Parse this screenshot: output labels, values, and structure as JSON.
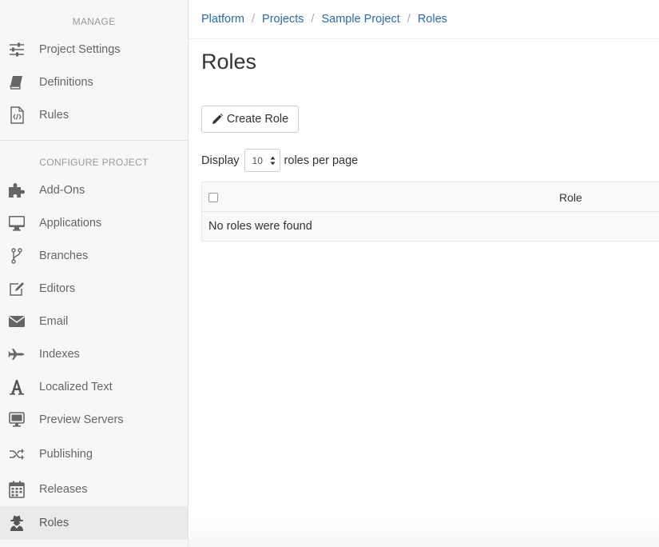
{
  "sidebar": {
    "manage_header": "MANAGE",
    "manage_items": [
      {
        "label": "Project Settings",
        "icon": "sliders-icon"
      },
      {
        "label": "Definitions",
        "icon": "book-icon"
      },
      {
        "label": "Rules",
        "icon": "code-file-icon"
      }
    ],
    "configure_header": "CONFIGURE PROJECT",
    "configure_items": [
      {
        "label": "Add-Ons",
        "icon": "puzzle-icon"
      },
      {
        "label": "Applications",
        "icon": "monitor-icon"
      },
      {
        "label": "Branches",
        "icon": "branch-icon"
      },
      {
        "label": "Editors",
        "icon": "edit-icon"
      },
      {
        "label": "Email",
        "icon": "envelope-icon"
      },
      {
        "label": "Indexes",
        "icon": "plane-icon"
      },
      {
        "label": "Localized Text",
        "icon": "font-icon"
      },
      {
        "label": "Preview Servers",
        "icon": "desktop-icon"
      },
      {
        "label": "Publishing",
        "icon": "shuffle-icon"
      },
      {
        "label": "Releases",
        "icon": "calendar-icon"
      },
      {
        "label": "Roles",
        "icon": "user-secret-icon",
        "active": true
      }
    ]
  },
  "breadcrumb": [
    "Platform",
    "Projects",
    "Sample Project",
    "Roles"
  ],
  "page": {
    "title": "Roles",
    "create_button": "Create Role",
    "display_prefix": "Display",
    "page_size": "10",
    "display_suffix": "roles per page"
  },
  "table": {
    "columns": [
      "Role"
    ],
    "empty_message": "No roles were found"
  },
  "colors": {
    "link": "#2a6ab0",
    "sidebar_bg": "#f7f7f7",
    "active_bg": "#eaeaea"
  }
}
